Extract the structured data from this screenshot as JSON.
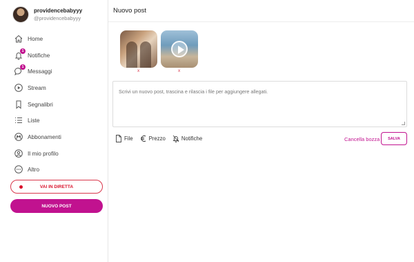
{
  "profile": {
    "name": "providencebabyyy",
    "handle": "@providencebabyyy"
  },
  "nav": [
    {
      "label": "Home",
      "icon": "home-icon"
    },
    {
      "label": "Notifiche",
      "icon": "bell-icon",
      "badge": "1"
    },
    {
      "label": "Messaggi",
      "icon": "chat-icon",
      "badge": "1"
    },
    {
      "label": "Stream",
      "icon": "play-circle-icon"
    },
    {
      "label": "Segnalibri",
      "icon": "bookmark-icon"
    },
    {
      "label": "Liste",
      "icon": "list-icon"
    },
    {
      "label": "Abbonamenti",
      "icon": "subscriptions-icon"
    },
    {
      "label": "Il mio profilo",
      "icon": "user-circle-icon"
    },
    {
      "label": "Altro",
      "icon": "more-icon"
    }
  ],
  "buttons": {
    "live": "VAI IN DIRETTA",
    "new_post": "NUOVO POST"
  },
  "page": {
    "title": "Nuovo post"
  },
  "attachments": [
    {
      "type": "image",
      "remove": "x"
    },
    {
      "type": "video",
      "remove": "x"
    }
  ],
  "composer": {
    "placeholder": "Scrivi un nuovo post, trascina e rilascia i file per aggiungere allegati.",
    "value": ""
  },
  "toolbar": {
    "file": "File",
    "price": "Prezzo",
    "notifications": "Notifiche"
  },
  "actions": {
    "cancel_draft": "Cancella bozza",
    "save": "SALVA"
  },
  "colors": {
    "accent": "#c1128f",
    "live": "#d9102a"
  }
}
